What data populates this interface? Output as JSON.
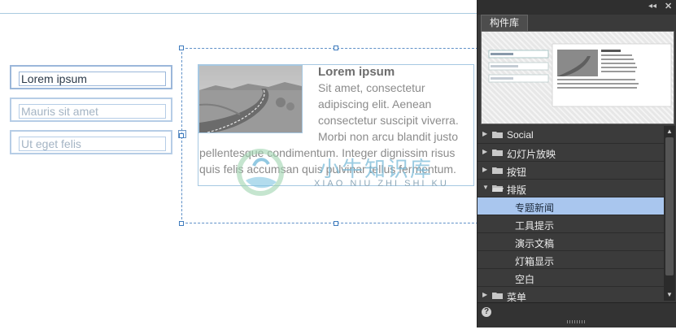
{
  "canvas": {
    "fields": [
      {
        "text": "Lorem ipsum"
      },
      {
        "text": "Mauris sit amet"
      },
      {
        "text": "Ut eget felis"
      }
    ],
    "article": {
      "title": "Lorem ipsum",
      "lines": [
        "Sit amet, consectetur",
        "adipiscing elit. Aenean",
        "consectetur suscipit viverra.",
        "Morbi non arcu blandit justo",
        "pellentesque condimentum. Integer dignissim risus",
        "quis felis accumsan quis pulvinar tellus fermentum."
      ]
    },
    "watermark": {
      "title": "小牛知识库",
      "subtitle": "XIAO NIU ZHI SHI KU"
    }
  },
  "panel": {
    "tab": "构件库",
    "controls": {
      "collapse": "◂◂",
      "close": "✕"
    },
    "tree": [
      {
        "label": "Social",
        "level": 0,
        "folder": true,
        "expanded": false
      },
      {
        "label": "幻灯片放映",
        "level": 0,
        "folder": true,
        "expanded": false
      },
      {
        "label": "按钮",
        "level": 0,
        "folder": true,
        "expanded": false
      },
      {
        "label": "排版",
        "level": 0,
        "folder": true,
        "expanded": true
      },
      {
        "label": "专题新闻",
        "level": 1,
        "folder": false,
        "selected": true
      },
      {
        "label": "工具提示",
        "level": 1,
        "folder": false
      },
      {
        "label": "演示文稿",
        "level": 1,
        "folder": false
      },
      {
        "label": "灯箱显示",
        "level": 1,
        "folder": false
      },
      {
        "label": "空白",
        "level": 1,
        "folder": false
      },
      {
        "label": "菜单",
        "level": 0,
        "folder": true,
        "expanded": false
      }
    ],
    "help": "?"
  },
  "colors": {
    "selection": "#5f90c8",
    "panel_bg": "#3a3a3a",
    "selected_row": "#a9c6ee"
  }
}
